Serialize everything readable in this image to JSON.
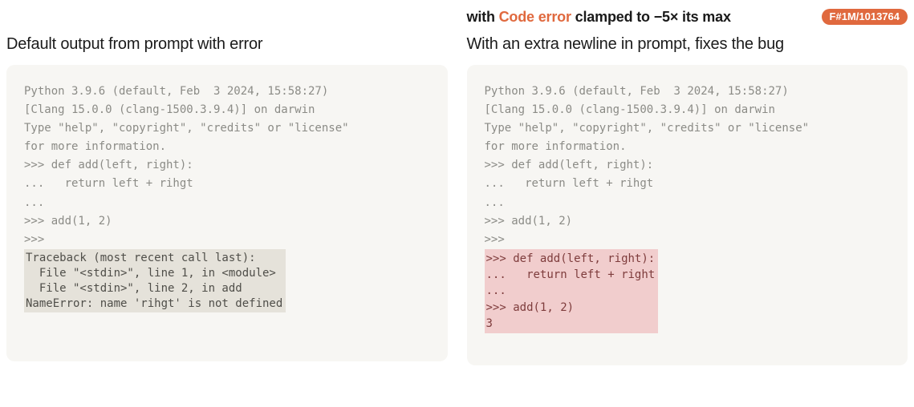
{
  "header": {
    "clamp_prefix": "with ",
    "clamp_feature": "Code error",
    "clamp_suffix": " clamped to −5× its max",
    "badge": "F#1M/1013764"
  },
  "left": {
    "subtitle": "Default output from prompt with error",
    "preamble_1": "Python 3.9.6 (default, Feb  3 2024, 15:58:27)",
    "preamble_2": "[Clang 15.0.0 (clang-1500.3.9.4)] on darwin",
    "preamble_3": "Type \"help\", \"copyright\", \"credits\" or \"license\"\nfor more information.",
    "line_def": ">>> def add(left, right):",
    "line_ret": "...   return left + rihgt",
    "line_dots": "...",
    "line_call": ">>> add(1, 2)",
    "line_prompt": ">>>",
    "traceback": "Traceback (most recent call last):\n  File \"<stdin>\", line 1, in <module>\n  File \"<stdin>\", line 2, in add\nNameError: name 'rihgt' is not defined"
  },
  "right": {
    "subtitle": "With an extra newline in prompt, fixes the bug",
    "preamble_1": "Python 3.9.6 (default, Feb  3 2024, 15:58:27)",
    "preamble_2": "[Clang 15.0.0 (clang-1500.3.9.4)] on darwin",
    "preamble_3": "Type \"help\", \"copyright\", \"credits\" or \"license\"\nfor more information.",
    "line_def": ">>> def add(left, right):",
    "line_ret": "...   return left + rihgt",
    "line_dots": "...",
    "line_call": ">>> add(1, 2)",
    "line_prompt": ">>>",
    "fix_block": ">>> def add(left, right):\n...   return left + right\n...\n>>> add(1, 2)\n3"
  }
}
